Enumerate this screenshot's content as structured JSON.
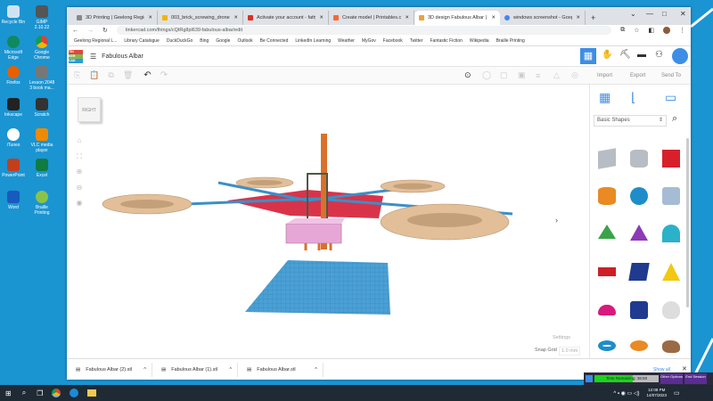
{
  "desktop": {
    "icons": [
      "Recycle Bin",
      "GIMP 2.10.22",
      "Microsoft Edge",
      "Google Chrome",
      "Firefox",
      "Lesson 2048 3 book ma...",
      "Inkscape",
      "Scratch",
      "iTunes",
      "VLC media player",
      "PowerPoint",
      "Excel",
      "Word",
      "Braille Printing"
    ]
  },
  "browser": {
    "tabs": [
      {
        "title": "3D Printing | Geelong Regional",
        "color": "#888"
      },
      {
        "title": "003_brick_screwing_drone - Go",
        "color": "#f4b400"
      },
      {
        "title": "Activate your account - fattybo",
        "color": "#d93025"
      },
      {
        "title": "Create model | Printables.com",
        "color": "#fa6831"
      },
      {
        "title": "3D design Fabulous Albar | Tink",
        "color": "#e8a33b",
        "active": true
      },
      {
        "title": "windows screenshot - Google S",
        "color": "#4285f4"
      }
    ],
    "new_tab": "+",
    "url": "tinkercad.com/things/cQtRg8pl639-fabulous-albar/edit",
    "bookmarks": [
      "Geelong Regional L...",
      "Library Catalogue",
      "DuckDuckGo",
      "Bing",
      "Google",
      "Outlook",
      "Be Connected",
      "LinkedIn Learning",
      "Weather",
      "MyGov",
      "Facebook",
      "Twitter",
      "Fantastic Fiction",
      "Wikipedia",
      "Braille Printing"
    ]
  },
  "tinkercad": {
    "logo": [
      "TIN",
      "KER",
      "CAD"
    ],
    "design_name": "Fabulous Albar",
    "actions": {
      "import": "Import",
      "export": "Export",
      "send_to": "Send To"
    },
    "view_cube": "RIGHT",
    "settings": "Settings",
    "snap_grid_label": "Snap Grid",
    "snap_grid_value": "1.0 mm",
    "shape_category": "Basic Shapes",
    "colors": {
      "accent": "#3d8ee6",
      "workplane": "#4a9fd4"
    }
  },
  "downloads": {
    "items": [
      "Fabulous Albar (2).stl",
      "Fabulous Albar (1).stl",
      "Fabulous Albar.stl"
    ],
    "show_all": "Show all"
  },
  "session": {
    "time_label": "Time Remaining: 36:50",
    "progress": 0.6,
    "other": "Other Options",
    "end": "End Session"
  },
  "taskbar": {
    "time": "12:08 PM",
    "date": "14/07/2023"
  }
}
